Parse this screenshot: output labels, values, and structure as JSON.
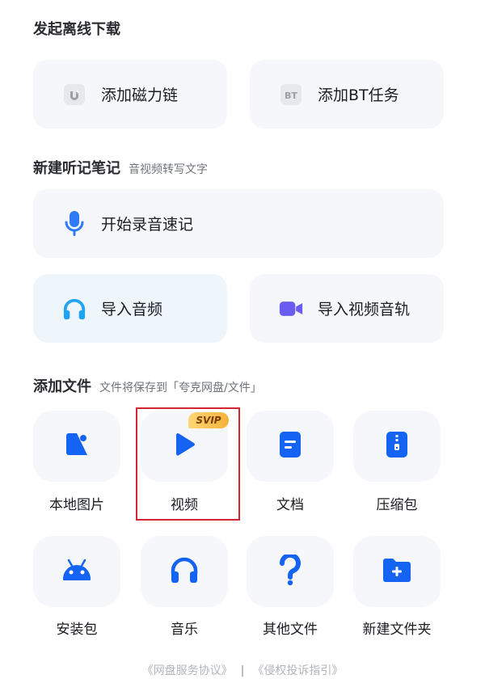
{
  "offline_download": {
    "title": "发起离线下载",
    "magnet_label": "添加磁力链",
    "bt_label": "添加BT任务",
    "bt_icon_text": "BT"
  },
  "notes": {
    "title": "新建听记笔记",
    "subtitle": "音视频转写文字",
    "record_label": "开始录音速记",
    "import_audio_label": "导入音频",
    "import_video_label": "导入视频音轨"
  },
  "add_files": {
    "title": "添加文件",
    "subtitle": "文件将保存到「夸克网盘/文件」",
    "svip_badge": "SVIP",
    "tiles": [
      {
        "label": "本地图片",
        "icon": "image-icon"
      },
      {
        "label": "视频",
        "icon": "play-icon"
      },
      {
        "label": "文档",
        "icon": "document-icon"
      },
      {
        "label": "压缩包",
        "icon": "zip-icon"
      },
      {
        "label": "安装包",
        "icon": "android-icon"
      },
      {
        "label": "音乐",
        "icon": "headphones-icon"
      },
      {
        "label": "其他文件",
        "icon": "question-icon"
      },
      {
        "label": "新建文件夹",
        "icon": "new-folder-icon"
      }
    ]
  },
  "footer": {
    "service_agreement": "《网盘服务协议》",
    "separator": "|",
    "infringement_guide": "《侵权投诉指引》"
  },
  "colors": {
    "accent": "#1463f3",
    "card_bg": "#f5f7fa",
    "highlight": "#d32531"
  }
}
